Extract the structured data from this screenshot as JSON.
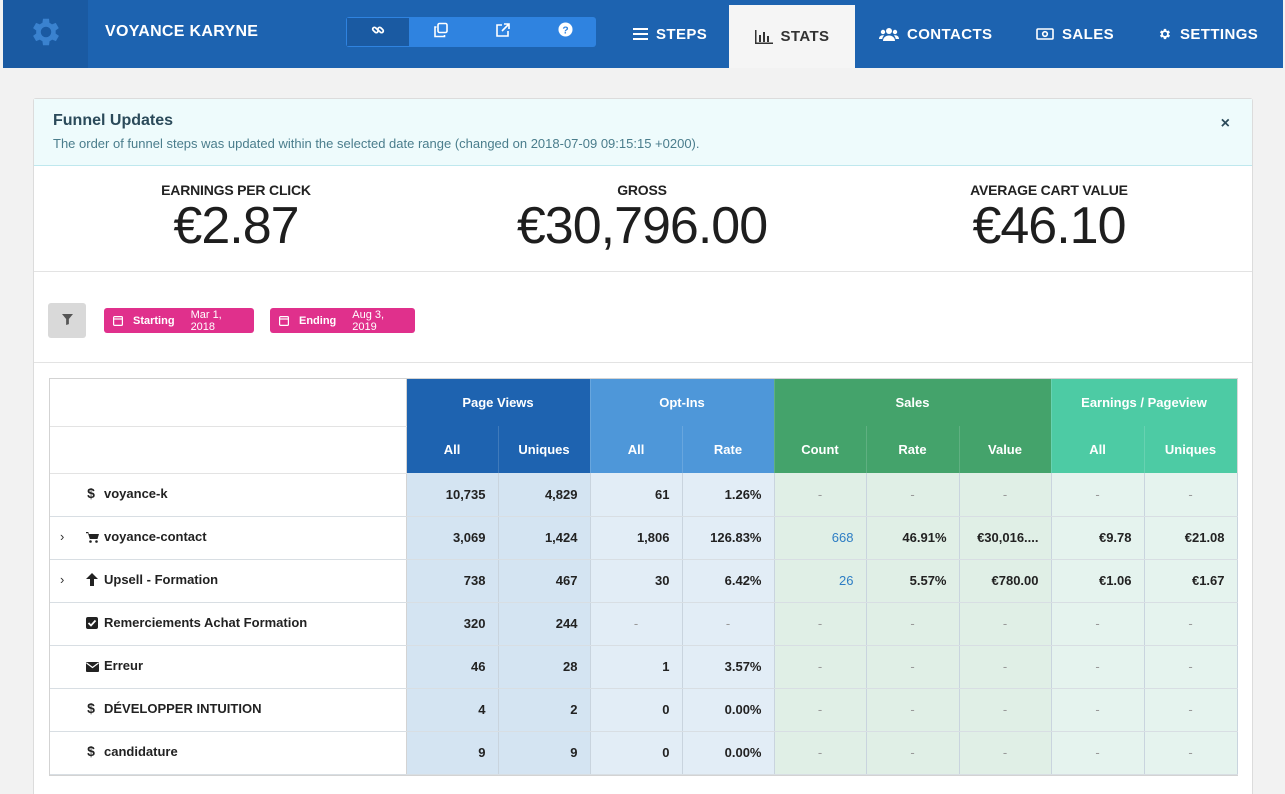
{
  "app": {
    "title": "VOYANCE KARYNE",
    "logo_icon": "gear-icon"
  },
  "toolbar": {
    "buttons": [
      "link-icon",
      "copy-icon",
      "external-link-icon",
      "help-icon"
    ]
  },
  "nav": {
    "steps": "STEPS",
    "stats": "STATS",
    "contacts": "CONTACTS",
    "sales": "SALES",
    "settings": "SETTINGS",
    "active": "STATS"
  },
  "alert": {
    "title": "Funnel Updates",
    "text": "The order of funnel steps was updated within the selected date range (changed on 2018-07-09 09:15:15 +0200).",
    "close": "×"
  },
  "kpis": {
    "epc_label": "EARNINGS PER CLICK",
    "epc_value": "€2.87",
    "gross_label": "GROSS",
    "gross_value": "€30,796.00",
    "acv_label": "AVERAGE CART VALUE",
    "acv_value": "€46.10"
  },
  "filters": {
    "starting_label": "Starting",
    "starting_value": "Mar 1, 2018",
    "ending_label": "Ending",
    "ending_value": "Aug 3, 2019"
  },
  "table": {
    "groups": {
      "page_views": "Page Views",
      "opt_ins": "Opt-Ins",
      "sales": "Sales",
      "earnings": "Earnings / Pageview"
    },
    "cols": {
      "pv_all": "All",
      "pv_uniques": "Uniques",
      "op_all": "All",
      "op_rate": "Rate",
      "sa_count": "Count",
      "sa_rate": "Rate",
      "sa_value": "Value",
      "ep_all": "All",
      "ep_uniques": "Uniques"
    },
    "rows": [
      {
        "expand": "",
        "icon": "dollar-icon",
        "name": "voyance-k",
        "pv_all": "10,735",
        "pv_uniques": "4,829",
        "op_all": "61",
        "op_rate": "1.26%",
        "sa_count": "-",
        "sa_rate": "-",
        "sa_value": "-",
        "ep_all": "-",
        "ep_uniques": "-"
      },
      {
        "expand": "›",
        "icon": "cart-icon",
        "name": "voyance-contact",
        "pv_all": "3,069",
        "pv_uniques": "1,424",
        "op_all": "1,806",
        "op_rate": "126.83%",
        "sa_count": "668",
        "sa_rate": "46.91%",
        "sa_value": "€30,016....",
        "ep_all": "€9.78",
        "ep_uniques": "€21.08"
      },
      {
        "expand": "›",
        "icon": "arrow-up-icon",
        "name": "Upsell - Formation",
        "pv_all": "738",
        "pv_uniques": "467",
        "op_all": "30",
        "op_rate": "6.42%",
        "sa_count": "26",
        "sa_rate": "5.57%",
        "sa_value": "€780.00",
        "ep_all": "€1.06",
        "ep_uniques": "€1.67"
      },
      {
        "expand": "",
        "icon": "checkbox-icon",
        "name": "Remerciements Achat Formation",
        "pv_all": "320",
        "pv_uniques": "244",
        "op_all": "-",
        "op_rate": "-",
        "sa_count": "-",
        "sa_rate": "-",
        "sa_value": "-",
        "ep_all": "-",
        "ep_uniques": "-"
      },
      {
        "expand": "",
        "icon": "envelope-icon",
        "name": "Erreur",
        "pv_all": "46",
        "pv_uniques": "28",
        "op_all": "1",
        "op_rate": "3.57%",
        "sa_count": "-",
        "sa_rate": "-",
        "sa_value": "-",
        "ep_all": "-",
        "ep_uniques": "-"
      },
      {
        "expand": "",
        "icon": "dollar-icon",
        "name": "DÉVELOPPER INTUITION",
        "pv_all": "4",
        "pv_uniques": "2",
        "op_all": "0",
        "op_rate": "0.00%",
        "sa_count": "-",
        "sa_rate": "-",
        "sa_value": "-",
        "ep_all": "-",
        "ep_uniques": "-"
      },
      {
        "expand": "",
        "icon": "dollar-icon",
        "name": "candidature",
        "pv_all": "9",
        "pv_uniques": "9",
        "op_all": "0",
        "op_rate": "0.00%",
        "sa_count": "-",
        "sa_rate": "-",
        "sa_value": "-",
        "ep_all": "-",
        "ep_uniques": "-"
      }
    ]
  },
  "colors": {
    "nav_bg": "#1d63b0",
    "page_views": "#1e63b0",
    "opt_ins": "#4e97d9",
    "sales": "#44a36b",
    "earnings": "#4dcba4",
    "date_pill": "#e0308c"
  }
}
